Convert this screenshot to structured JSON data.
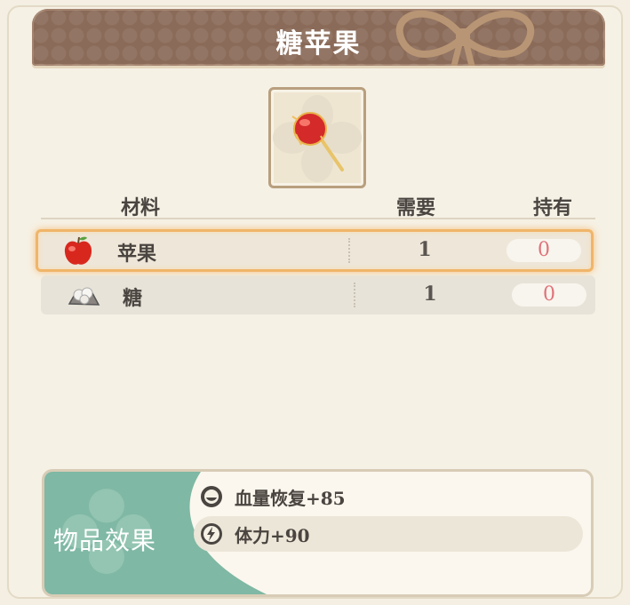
{
  "header": {
    "title": "糖苹果"
  },
  "item": {
    "name": "糖苹果",
    "icon": "candied-apple-icon"
  },
  "table": {
    "headers": {
      "material": "材料",
      "need": "需要",
      "have": "持有"
    },
    "rows": [
      {
        "icon": "apple-icon",
        "name": "苹果",
        "need": "1",
        "have": "0",
        "selected": true
      },
      {
        "icon": "sugar-icon",
        "name": "糖",
        "need": "1",
        "have": "0",
        "selected": false
      }
    ]
  },
  "effect": {
    "label": "物品效果",
    "lines": [
      {
        "icon": "hp-recovery-icon",
        "text": "血量恢复+85"
      },
      {
        "icon": "stamina-icon",
        "text": "体力+90"
      }
    ]
  },
  "colors": {
    "header_bg": "#8a6a58",
    "highlight": "#f0b56a",
    "have_value": "#e0737a",
    "effect_green": "#7fb8a4"
  }
}
